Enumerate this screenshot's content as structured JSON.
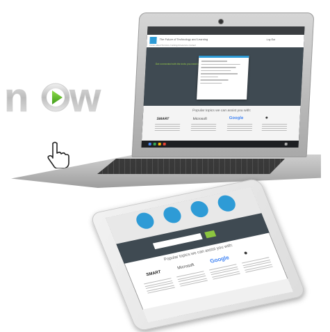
{
  "logo": {
    "text": "now"
  },
  "laptop": {
    "site_title": "The Future of Technology and Learning",
    "nav": "Home   About   Services   Training   Resources   Contact",
    "login": "Log Out",
    "hero_text": "Get connected with the tools you need today",
    "popular_title": "Popular topics we can assist you with:",
    "brands": [
      "SMART",
      "Microsoft",
      "Google",
      ""
    ]
  },
  "tablet": {
    "popular_title": "Popular topics we can assist you with:",
    "brands": [
      "SMART",
      "Microsoft",
      "Google",
      ""
    ]
  },
  "colors": {
    "accent_blue": "#2e9bd6",
    "accent_green": "#8cc63f",
    "dark_panel": "#3f4a52"
  }
}
